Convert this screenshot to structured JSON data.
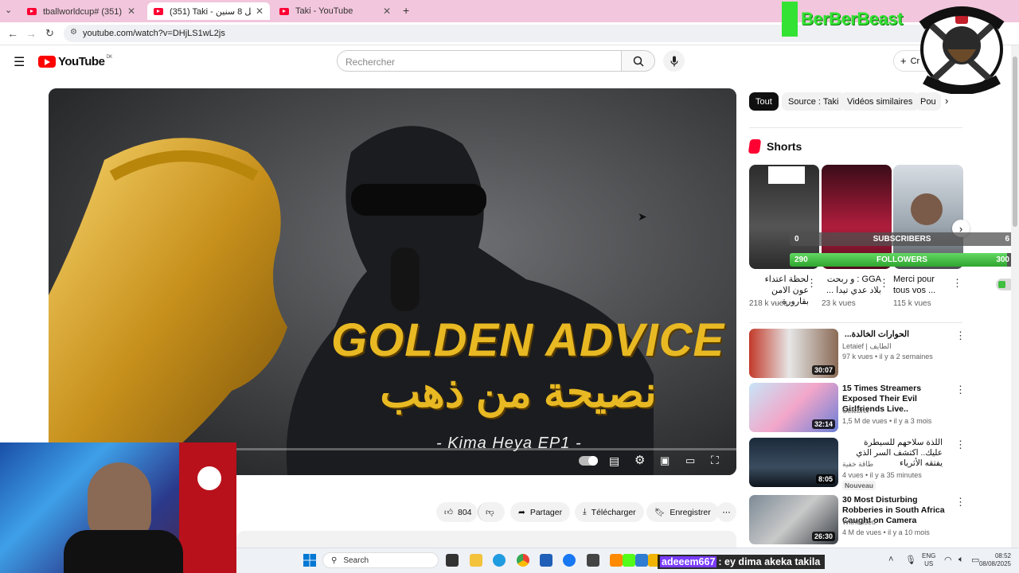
{
  "browser": {
    "tabs": [
      {
        "title": "#اكسيلور (351) #footballworldcup",
        "display": "tballworldcup# اكسيلور (351)#",
        "active": false
      },
      {
        "title": "(351) Taki - نصيحة تعرفها قبل 8 سنين",
        "display": "(351) Taki - ت تعرفها قبل 8 سنين",
        "active": true
      },
      {
        "title": "Taki - YouTube",
        "display": "Taki - YouTube",
        "active": false
      }
    ],
    "new_tab": "+",
    "url": "youtube.com/watch?v=DHjLS1wL2js"
  },
  "youtube": {
    "logo": "YouTube",
    "region": "DK",
    "search_placeholder": "Rechercher",
    "create_label": "Cr"
  },
  "video": {
    "overlay_title": "GOLDEN ADVICE",
    "overlay_arabic": "نصيحة من ذهب",
    "overlay_sub": "- Kima Heya EP1 -",
    "like_count": "804",
    "share_label": "Partager",
    "download_label": "Télécharger",
    "save_label": "Enregistrer"
  },
  "chips": [
    "Tout",
    "Source : Taki",
    "Vidéos similaires",
    "Pou"
  ],
  "shorts": {
    "heading": "Shorts",
    "items": [
      {
        "title": "لحظة اعتداء عون الامن بقارورة ...",
        "views": "218 k vues"
      },
      {
        "title": "GGA : و ربحت بلاد عدي تيدا ...",
        "views": "23 k vues"
      },
      {
        "title": "Merci pour tous vos ...",
        "views": "115 k vues"
      }
    ]
  },
  "recommendations": [
    {
      "title": "الحوارات الخالدة...",
      "channel": "Letaief | الطايف",
      "meta": "97 k vues • il y a 2 semaines",
      "duration": "30:07",
      "badge": ""
    },
    {
      "title": "15 Times Streamers Exposed Their Evil Girlfriends Live..",
      "channel": "Celebrix",
      "meta": "1,5 M de vues • il y a 3 mois",
      "duration": "32:14",
      "badge": ""
    },
    {
      "title": "اللذة سلاحهم للسيطرة عليك.. اكتشف السر الذي يفتقه الأثرياء",
      "channel": "طاقة خفية",
      "meta": "4 vues • il y a 35 minutes",
      "duration": "8:05",
      "badge": "Nouveau"
    },
    {
      "title": "30 Most Disturbing Robberies in South Africa Caught on Camera",
      "channel": "Witnessed",
      "meta": "4 M de vues • il y a 10 mois",
      "duration": "26:30",
      "badge": ""
    }
  ],
  "overlay": {
    "brand": "BerBerBeast",
    "emblem": "BERBERBEAST GAMING",
    "subs_left": "0",
    "subs_label": "SUBSCRIBERS",
    "subs_right": "6",
    "follow_left": "290",
    "follow_label": "FOLLOWERS",
    "follow_right": "300",
    "follow_progress": 0.967,
    "chat_user": "adeeem667",
    "chat_message": ": ey dima akeka takila"
  },
  "taskbar": {
    "search_label": "Search",
    "lang": "ENG",
    "region": "US",
    "time": "08:52",
    "date": "08/08/2025"
  },
  "colors": {
    "brand_red": "#ff0000",
    "gold": "#e8b923",
    "progress_green": "#3fbf3f"
  }
}
